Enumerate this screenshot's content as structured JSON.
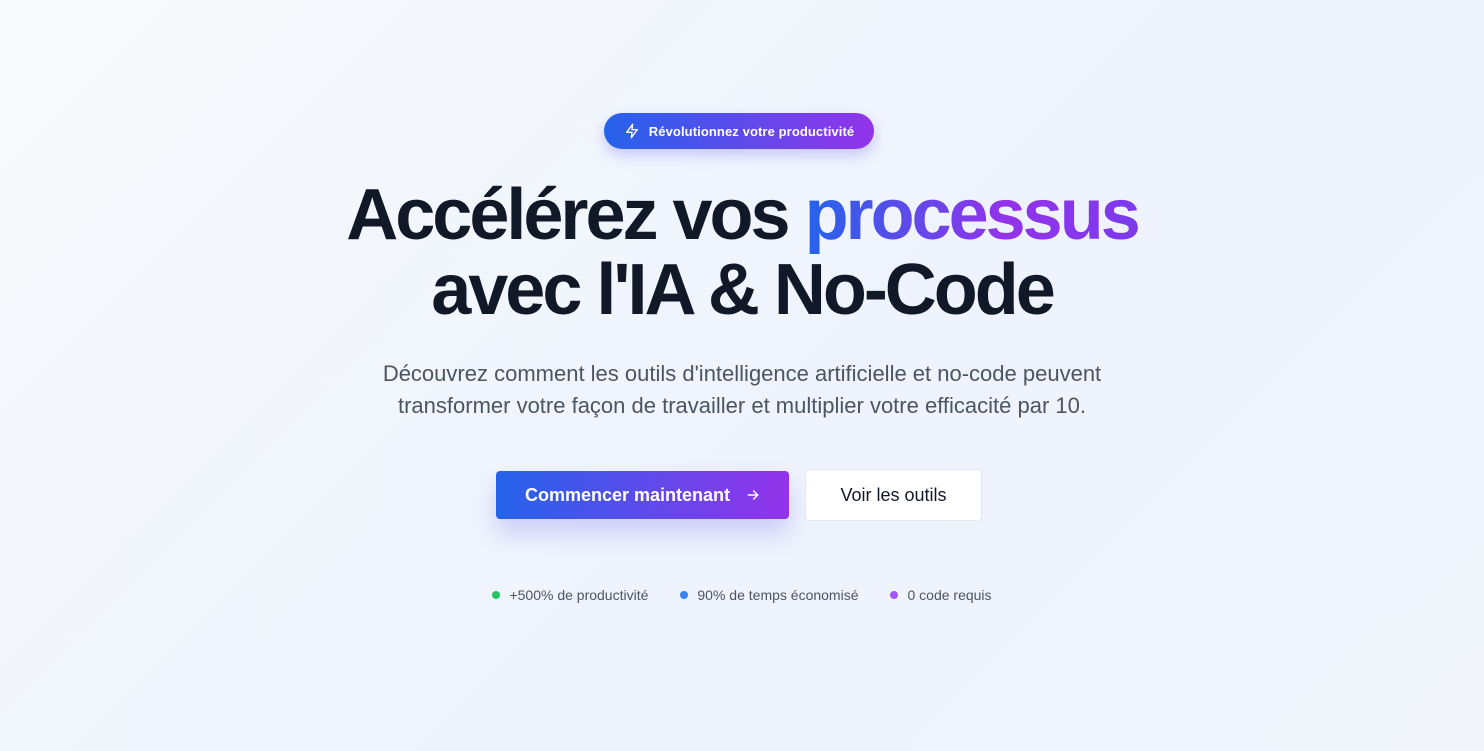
{
  "badge": {
    "icon": "lightning-icon",
    "label": "Révolutionnez votre productivité"
  },
  "headline": {
    "part1": "Accélérez vos ",
    "accent": "processus",
    "line2": "avec l'IA & No-Code"
  },
  "subtitle": "Découvrez comment les outils d'intelligence artificielle et no-code peuvent transformer votre façon de travailler et multiplier votre efficacité par 10.",
  "actions": {
    "primary_label": "Commencer maintenant",
    "primary_icon": "arrow-right-icon",
    "secondary_label": "Voir les outils"
  },
  "stats": [
    {
      "label": "+500% de productivité",
      "color": "#22c55e"
    },
    {
      "label": "90% de temps économisé",
      "color": "#3b82f6"
    },
    {
      "label": "0 code requis",
      "color": "#a855f7"
    }
  ],
  "colors": {
    "gradient_start": "#2563eb",
    "gradient_end": "#9333ea",
    "headline": "#111827",
    "body_text": "#4b5563"
  }
}
